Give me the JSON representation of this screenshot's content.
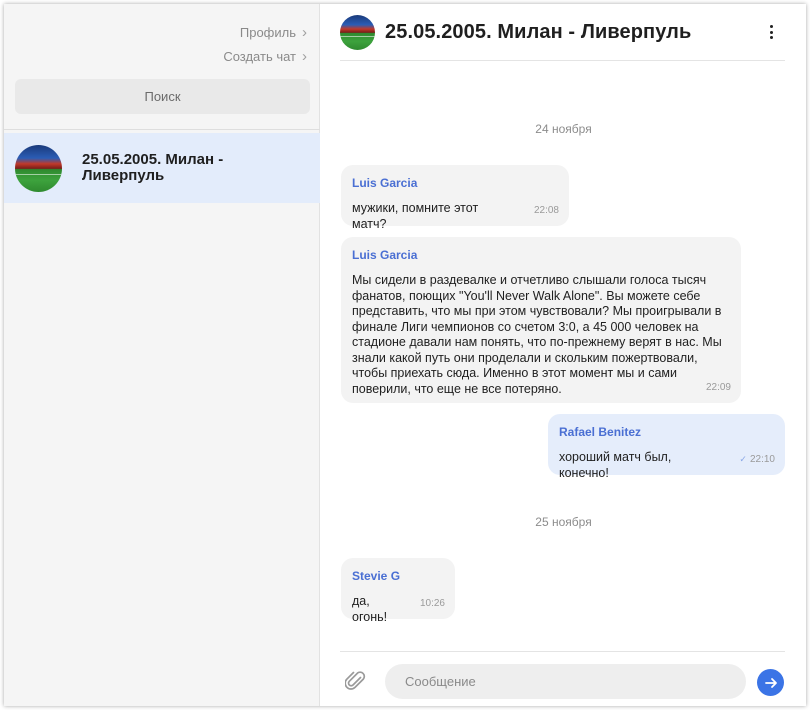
{
  "sidebar": {
    "profile_link": "Профиль",
    "create_chat_link": "Создать чат",
    "search_label": "Поиск",
    "chats": [
      {
        "name": "25.05.2005. Милан - Ливерпуль"
      }
    ]
  },
  "chat": {
    "title": "25.05.2005. Милан - Ливерпуль",
    "date_separators": [
      "24 ноября",
      "25 ноября"
    ],
    "messages": [
      {
        "author": "Luis Garcia",
        "text": "мужики, помните этот матч?",
        "time": "22:08",
        "outgoing": false
      },
      {
        "author": "Luis Garcia",
        "text": "Мы сидели в раздевалке и отчетливо слышали голоса тысяч фанатов, поющих \"You'll Never Walk Alone\". Вы можете себе представить, что мы при этом чувствовали? Мы проигрывали в финале Лиги чемпионов со счетом 3:0, а 45 000 человек на стадионе давали нам понять, что по-прежнему верят в нас. Мы знали какой путь они проделали и скольким пожертвовали, чтобы приехать сюда. Именно в этот момент мы и сами поверили, что еще не все потеряно.",
        "time": "22:09",
        "outgoing": false
      },
      {
        "author": "Rafael Benitez",
        "text": "хороший матч был, конечно!",
        "time": "22:10",
        "outgoing": true
      },
      {
        "author": "Stevie G",
        "text": "да, огонь!",
        "time": "10:26",
        "outgoing": false
      }
    ]
  },
  "composer": {
    "placeholder": "Сообщение"
  },
  "colors": {
    "accent": "#3b74e6",
    "author": "#4a6fd3",
    "selected_chat_bg": "#e3ecfb",
    "outgoing_bubble": "#e5edfb"
  },
  "icons": {
    "chevron": "chevron-right-icon",
    "menu": "more-vertical-icon",
    "attach": "paperclip-icon",
    "send": "arrow-right-icon",
    "read": "check-icon"
  }
}
